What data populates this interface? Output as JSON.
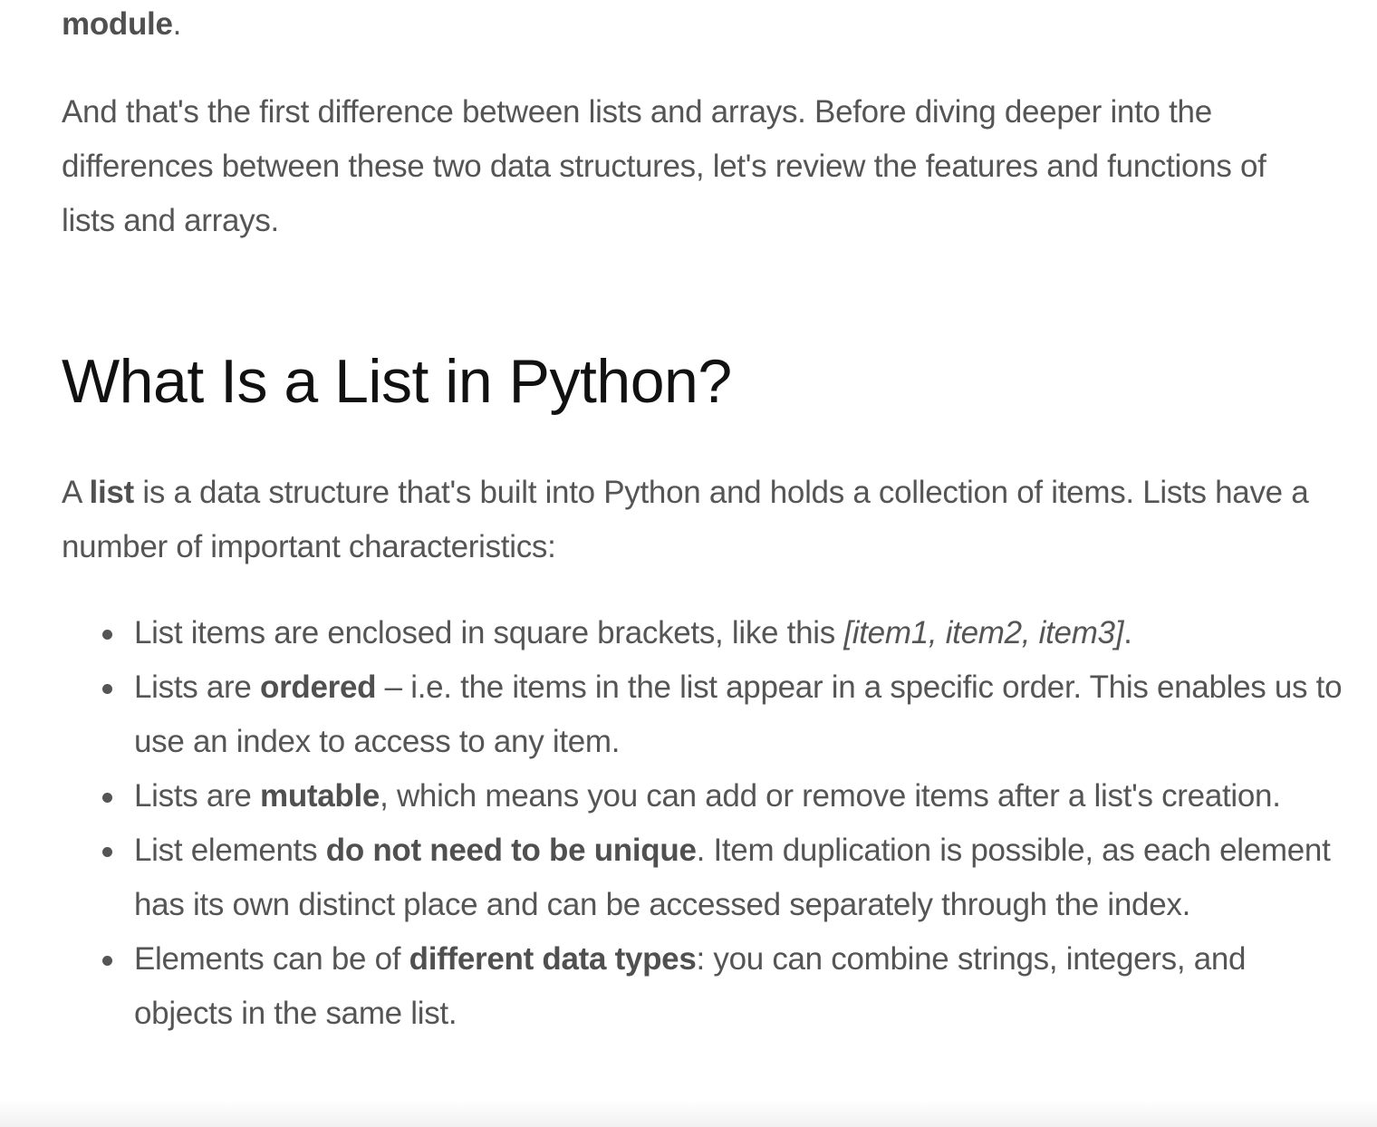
{
  "module_line": {
    "bold": "module",
    "tail": "."
  },
  "intro_paragraph": "And that's the first difference between lists and arrays. Before diving deeper into the differences between these two data structures, let's review the features and functions of lists and arrays.",
  "heading": "What Is a List in Python?",
  "list_intro": {
    "pre": "A ",
    "bold": "list",
    "post": " is a data structure that's built into Python and holds a collection of items. Lists have a number of important characteristics:"
  },
  "bullets": [
    {
      "pre": "List items are enclosed in square brackets, like this ",
      "italic": "[item1, item2, item3]",
      "post": "."
    },
    {
      "pre": "Lists are ",
      "bold": "ordered",
      "post": " – i.e. the items in the list appear in a specific order. This enables us to use an index to access to any item."
    },
    {
      "pre": "Lists are ",
      "bold": "mutable",
      "post": ", which means you can add or remove items after a list's creation."
    },
    {
      "pre": "List elements ",
      "bold": "do not need to be unique",
      "post": ". Item duplication is possible, as each element has its own distinct place and can be accessed separately through the index."
    },
    {
      "pre": "Elements can be of ",
      "bold": "different data types",
      "post": ": you can combine strings, integers, and objects in the same list."
    }
  ]
}
